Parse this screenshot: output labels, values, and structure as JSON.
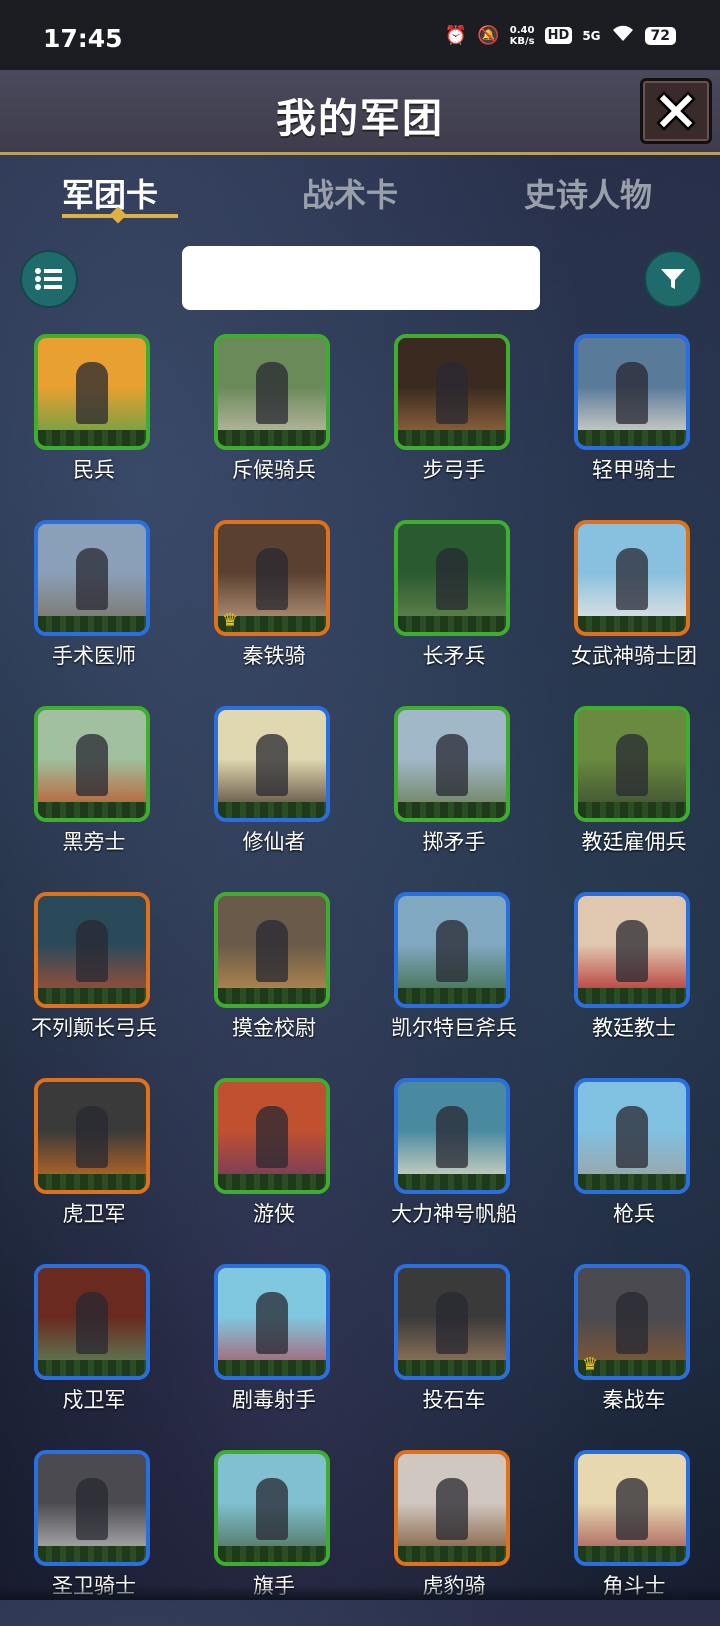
{
  "status_bar": {
    "time": "17:45",
    "net_speed_value": "0.40",
    "net_speed_unit": "KB/s",
    "hd": "HD",
    "signal": "5G",
    "battery": "72",
    "icons": [
      "alarm-icon",
      "mute-icon",
      "wifi-icon"
    ]
  },
  "header": {
    "title": "我的军团",
    "close_icon": "close-icon"
  },
  "tabs": [
    {
      "label": "军团卡",
      "active": true
    },
    {
      "label": "战术卡",
      "active": false
    },
    {
      "label": "史诗人物",
      "active": false
    }
  ],
  "toolbar": {
    "list_icon": "list-icon",
    "filter_icon": "filter-icon",
    "search_value": ""
  },
  "colors": {
    "green": "#3fae2f",
    "blue": "#2a6fe0",
    "orange": "#e0701a",
    "accent": "#e0b040"
  },
  "units": [
    {
      "name": "民兵",
      "rarity": "green",
      "crown": false
    },
    {
      "name": "斥候骑兵",
      "rarity": "green",
      "crown": false
    },
    {
      "name": "步弓手",
      "rarity": "green",
      "crown": false
    },
    {
      "name": "轻甲骑士",
      "rarity": "blue",
      "crown": false
    },
    {
      "name": "手术医师",
      "rarity": "blue",
      "crown": false
    },
    {
      "name": "秦铁骑",
      "rarity": "orange",
      "crown": true
    },
    {
      "name": "长矛兵",
      "rarity": "green",
      "crown": false
    },
    {
      "name": "女武神骑士团",
      "rarity": "orange",
      "crown": false
    },
    {
      "name": "黑旁士",
      "rarity": "green",
      "crown": false
    },
    {
      "name": "修仙者",
      "rarity": "blue",
      "crown": false
    },
    {
      "name": "掷矛手",
      "rarity": "green",
      "crown": false
    },
    {
      "name": "教廷雇佣兵",
      "rarity": "green",
      "crown": false
    },
    {
      "name": "不列颠长弓兵",
      "rarity": "orange",
      "crown": false
    },
    {
      "name": "摸金校尉",
      "rarity": "green",
      "crown": false
    },
    {
      "name": "凯尔特巨斧兵",
      "rarity": "blue",
      "crown": false
    },
    {
      "name": "教廷教士",
      "rarity": "blue",
      "crown": false
    },
    {
      "name": "虎卫军",
      "rarity": "orange",
      "crown": false
    },
    {
      "name": "游侠",
      "rarity": "green",
      "crown": false
    },
    {
      "name": "大力神号帆船",
      "rarity": "blue",
      "crown": false
    },
    {
      "name": "枪兵",
      "rarity": "blue",
      "crown": false
    },
    {
      "name": "戍卫军",
      "rarity": "blue",
      "crown": false
    },
    {
      "name": "剧毒射手",
      "rarity": "blue",
      "crown": false
    },
    {
      "name": "投石车",
      "rarity": "blue",
      "crown": false
    },
    {
      "name": "秦战车",
      "rarity": "blue",
      "crown": true
    },
    {
      "name": "圣卫骑士",
      "rarity": "blue",
      "crown": false
    },
    {
      "name": "旗手",
      "rarity": "green",
      "crown": false
    },
    {
      "name": "虎豹骑",
      "rarity": "orange",
      "crown": false
    },
    {
      "name": "角斗士",
      "rarity": "blue",
      "crown": false
    }
  ]
}
